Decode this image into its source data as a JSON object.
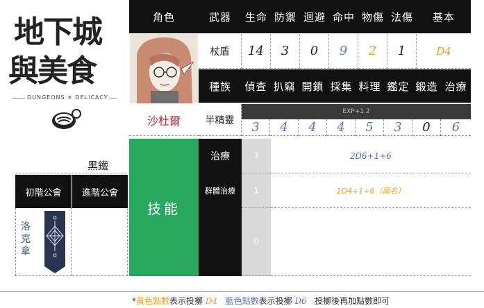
{
  "logo": {
    "title_line1": "地下城",
    "title_line2": "與美食",
    "subtitle": "DUNGEONS",
    "subtitle2": "DELICACY"
  },
  "header": {
    "role": "角色",
    "weapon": "武器",
    "life": "生命",
    "defense": "防禦",
    "evade": "迴避",
    "hit": "命中",
    "phys": "物傷",
    "magic": "法傷",
    "basic": "基本"
  },
  "stats": {
    "weapon": "杖盾",
    "life": "14",
    "defense": "3",
    "evade": "0",
    "hit": "9",
    "phys": "2",
    "magic": "1",
    "basic": "D4"
  },
  "skills_header": {
    "race": "種族",
    "investigate": "偵查",
    "pick": "扒竊",
    "unlock": "開鎖",
    "gather": "採集",
    "cook": "料理",
    "appraise": "鑑定",
    "forge": "鍛造",
    "heal": "治療"
  },
  "skills_values": {
    "investigate": "3",
    "pick": "4",
    "unlock": "4",
    "gather": "4",
    "cook": "5",
    "appraise": "3",
    "forge": "0",
    "heal": "6"
  },
  "character": {
    "name": "沙杜爾",
    "race": "半精靈",
    "exp": "EXP+1.2",
    "rank": "黑鐵"
  },
  "guild": {
    "first": "初階公會",
    "advanced": "進階公會",
    "first_name": "洛克拿"
  },
  "abilities": {
    "label": "技能",
    "rows": [
      {
        "name": "治療",
        "cost": "3",
        "effect": "2D6+1+6"
      },
      {
        "name": "群體治療",
        "cost": "1",
        "effect": "1D4+1+6（兩名）"
      },
      {
        "name": "",
        "cost": "0",
        "effect": ""
      }
    ]
  },
  "footer": {
    "star": "*",
    "yellow": "黃色點數",
    "show1": "表示投擲",
    "d4": "D4",
    "blue": "藍色點數",
    "show2": "表示投擲",
    "d6": "D6",
    "tail": "投擲後再加點數即可"
  },
  "colors": {
    "green": "#27a85e",
    "blue": "#5a78c8",
    "orange": "#f0a020",
    "red": "#d0202a",
    "black": "#111111"
  }
}
